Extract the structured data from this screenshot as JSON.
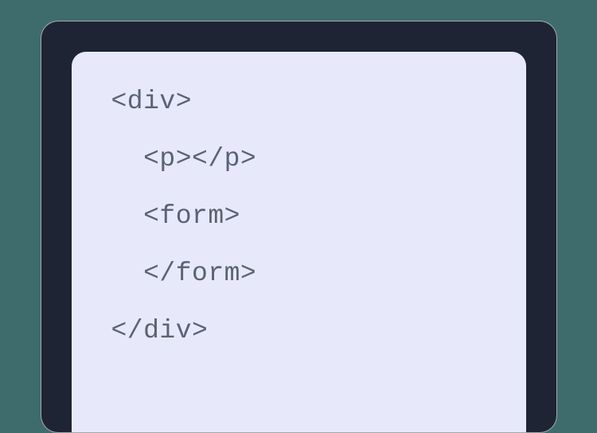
{
  "code": {
    "lines": [
      "<div>",
      "  <p></p>",
      "  <form>",
      "  </form>",
      "</div>"
    ]
  }
}
